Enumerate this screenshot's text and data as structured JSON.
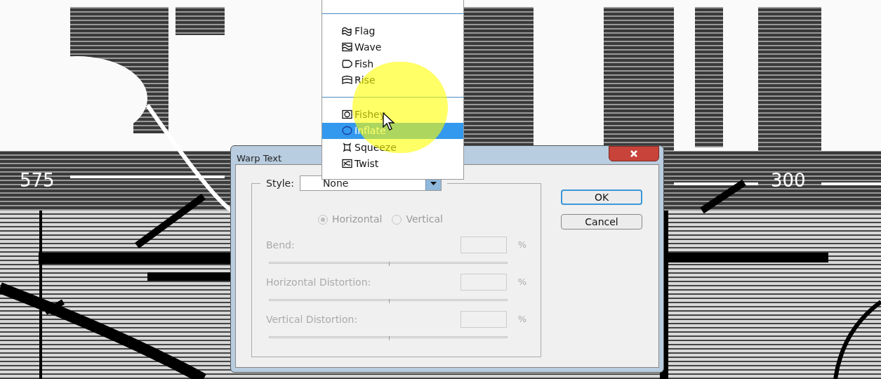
{
  "canvas_labels": [
    "575",
    "300"
  ],
  "dialog": {
    "title": "Warp Text",
    "style": {
      "label": "Style:",
      "value": "None"
    },
    "orientation": [
      {
        "label": "Horizontal",
        "selected": true,
        "disabled": true
      },
      {
        "label": "Vertical",
        "selected": false,
        "disabled": true
      }
    ],
    "settings": [
      {
        "label": "Bend:",
        "unit": "%",
        "disabled": true
      },
      {
        "label": "Horizontal Distortion:",
        "unit": "%",
        "disabled": true
      },
      {
        "label": "Vertical Distortion:",
        "unit": "%",
        "disabled": true
      }
    ],
    "buttons": [
      {
        "label": "OK",
        "kind": "default"
      },
      {
        "label": "Cancel",
        "kind": "normal"
      }
    ]
  },
  "style_menu": {
    "groups": [
      [
        {
          "label": "Flag",
          "kind": "flag",
          "selected": false
        },
        {
          "label": "Wave",
          "kind": "wave",
          "selected": false
        },
        {
          "label": "Fish",
          "kind": "fish",
          "selected": false
        },
        {
          "label": "Rise",
          "kind": "rise",
          "selected": false
        }
      ],
      [
        {
          "label": "Fishey",
          "kind": "fisheye",
          "selected": false
        },
        {
          "label": "Inflate",
          "kind": "inflate",
          "selected": true
        },
        {
          "label": "Squeeze",
          "kind": "squeeze",
          "selected": false
        },
        {
          "label": "Twist",
          "kind": "twist",
          "selected": false
        }
      ]
    ]
  }
}
